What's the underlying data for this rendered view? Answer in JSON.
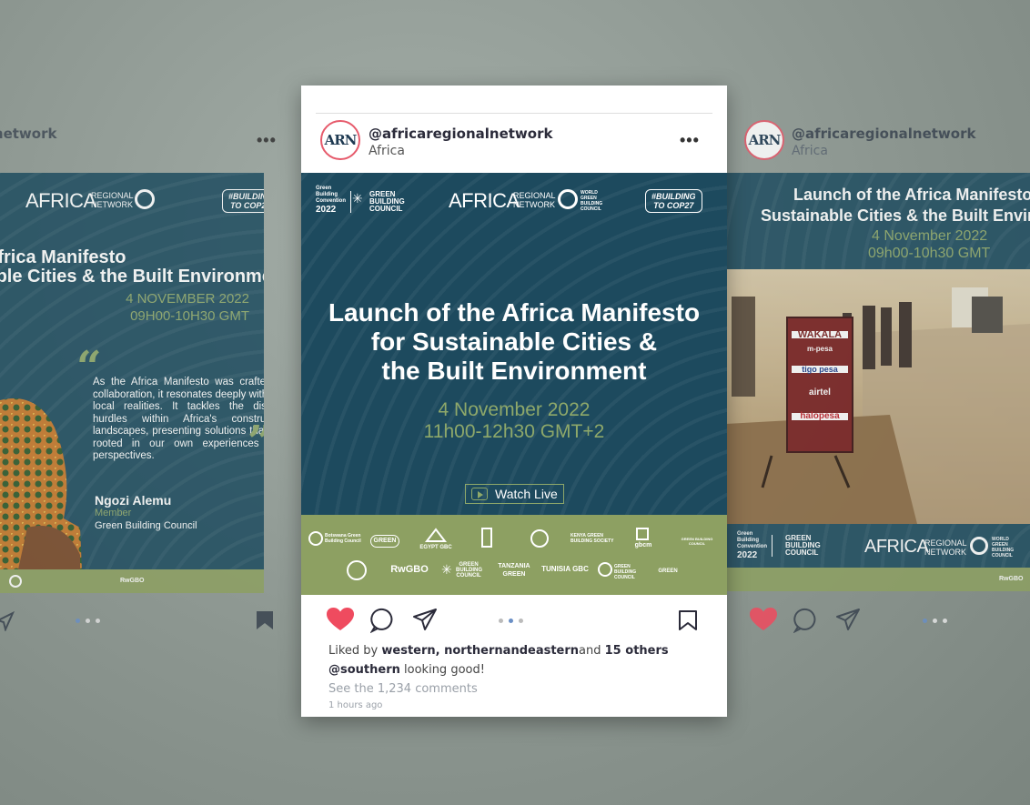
{
  "left_post": {
    "handle": "@africaregionalnetwork",
    "logo": {
      "africa": "AFRICA",
      "network": "REGIONAL\nNETWORK",
      "cop": "#BUILDING\nTO COP27"
    },
    "title_line1": "Launch of the Africa Manifesto",
    "title_line2": "for Sustainable Cities & the Built Environment",
    "date": "4 NOVEMBER 2022",
    "time": "09H00-10H30 GMT",
    "quote": "As the Africa Manifesto was crafted in collaboration, it resonates deeply with our local realities. It tackles the distinct hurdles within Africa's constructed landscapes, presenting solutions that are rooted in our own experiences and perspectives.",
    "speaker_name": "Ngozi Alemu",
    "speaker_role": "Member",
    "speaker_org": "Green Building Council"
  },
  "center_post": {
    "handle": "@africaregionalnetwork",
    "location": "Africa",
    "avatar": "ARN",
    "convention": {
      "line1": "Green",
      "line2": "Building",
      "line3": "Convention",
      "year": "2022",
      "gbc": "GREEN\nBUILDING\nCOUNCIL"
    },
    "logo": {
      "africa": "AFRICA",
      "network": "REGIONAL\nNETWORK",
      "wgbc": "WORLD\nGREEN\nBUILDING\nCOUNCIL",
      "cop": "#BUILDING\nTO COP27"
    },
    "title": [
      "Launch of the Africa Manifesto",
      "for Sustainable Cities &",
      "the Built Environment"
    ],
    "date": "4 November 2022",
    "time": "11h00-12h30 GMT+2",
    "watch_label": "Watch Live",
    "sponsors_row1": [
      "Botswana Green Building Council",
      "GREEN",
      "EGYPT GBC",
      "",
      "",
      "KENYA GREEN BUILDING SOCIETY",
      "gbcm",
      "GREEN BUILDING COUNCIL"
    ],
    "sponsors_row2": [
      "",
      "RwGBO",
      "GREEN BUILDING COUNCIL",
      "TANZANIA GREEN",
      "TUNISIA GBC",
      "GREEN BUILDING COUNCIL",
      "GREEN"
    ],
    "liked_prefix": "Liked by",
    "liked_users": "western, northernandeastern",
    "liked_and": "and",
    "liked_others": "15 others",
    "caption_user": "@southern",
    "caption_text": "looking good!",
    "see_comments": "See the 1,234 comments",
    "time_ago": "1 hours ago"
  },
  "right_post": {
    "handle": "@africaregionalnetwork",
    "location": "Africa",
    "avatar": "ARN",
    "title_line1": "Launch of the Africa Manifesto",
    "title_line2": "Sustainable Cities & the Built Environment",
    "date": "4 November 2022",
    "time": "09h00-10h30 GMT",
    "sign_lines": [
      "WAKALA",
      "m-pesa",
      "tigo pesa",
      "airtel",
      "halopesa"
    ],
    "convention": {
      "line1": "Green",
      "line2": "Building",
      "line3": "Convention",
      "year": "2022",
      "gbc": "GREEN\nBUILDING\nCOUNCIL"
    },
    "logo": {
      "africa": "AFRICA",
      "network": "REGIONAL\nNETWORK",
      "wgbc": "WORLD\nGREEN\nBUILDING\nCOUNCIL"
    },
    "sponsor_tail": "RwGBO"
  },
  "colors": {
    "banner": "#1d4a5e",
    "accent_green": "#8da062",
    "heart": "#ef4b5f",
    "dot_active": "#6a8fc5"
  }
}
